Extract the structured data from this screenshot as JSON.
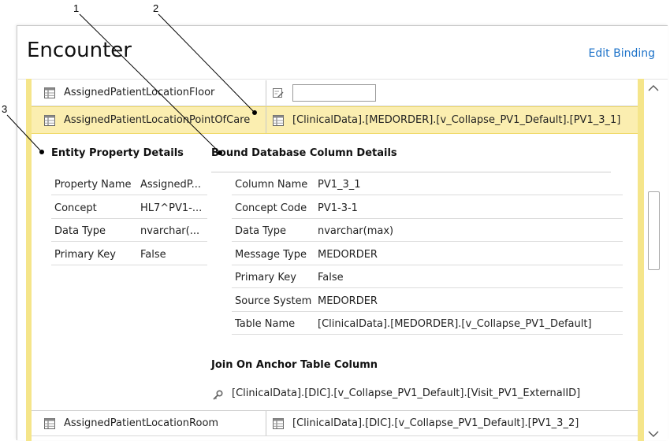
{
  "panel": {
    "title": "Encounter",
    "edit_binding_label": "Edit Binding"
  },
  "callouts": [
    "1",
    "2",
    "3"
  ],
  "rows": {
    "floor": {
      "name": "AssignedPatientLocationFloor",
      "value": ""
    },
    "point_of_care": {
      "name": "AssignedPatientLocationPointOfCare",
      "value": "[ClinicalData].[MEDORDER].[v_Collapse_PV1_Default].[PV1_3_1]"
    },
    "room": {
      "name": "AssignedPatientLocationRoom",
      "value": "[ClinicalData].[DIC].[v_Collapse_PV1_Default].[PV1_3_2]"
    }
  },
  "entity_details": {
    "title": "Entity Property Details",
    "items": [
      {
        "label": "Property Name",
        "value": "AssignedP..."
      },
      {
        "label": "Concept",
        "value": "HL7^PV1-..."
      },
      {
        "label": "Data Type",
        "value": "nvarchar(..."
      },
      {
        "label": "Primary Key",
        "value": "False"
      }
    ]
  },
  "column_details": {
    "title": "Bound Database Column Details",
    "items": [
      {
        "label": "Column Name",
        "value": "PV1_3_1"
      },
      {
        "label": "Concept Code",
        "value": "PV1-3-1"
      },
      {
        "label": "Data Type",
        "value": "nvarchar(max)"
      },
      {
        "label": "Message Type",
        "value": "MEDORDER"
      },
      {
        "label": "Primary Key",
        "value": "False"
      },
      {
        "label": "Source System",
        "value": "MEDORDER"
      },
      {
        "label": "Table Name",
        "value": "[ClinicalData].[MEDORDER].[v_Collapse_PV1_Default]"
      }
    ],
    "join_title": "Join On Anchor Table Column",
    "join_value": "[ClinicalData].[DIC].[v_Collapse_PV1_Default].[Visit_PV1_ExternalID]"
  },
  "icons": {
    "row_icon": "table-column-icon",
    "edit_icon": "edit-field-icon",
    "key_icon": "key-icon",
    "scroll_up": "chevron-up-icon",
    "scroll_down": "chevron-down-icon"
  },
  "colors": {
    "accent": "#1e73c9",
    "selection": "#fbeeb0",
    "selection_border": "#f5e58a"
  }
}
